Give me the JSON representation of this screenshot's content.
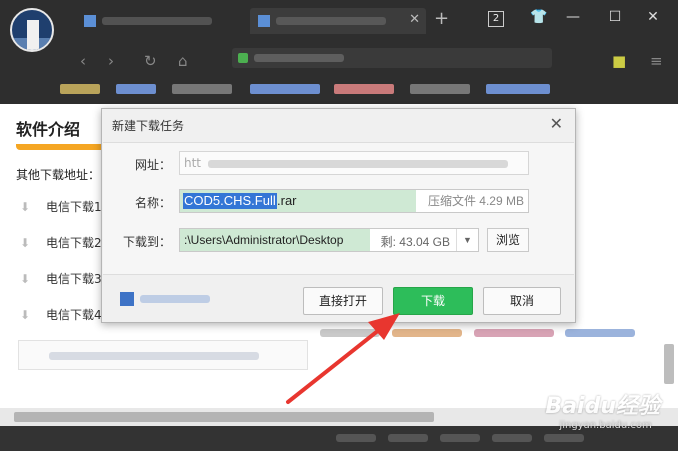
{
  "browser": {
    "tab_count": "2"
  },
  "page": {
    "section_title": "软件介绍",
    "other_links_label": "其他下载地址：",
    "download_links": [
      "电信下载1",
      "电信下载2",
      "电信下载3",
      "电信下载4"
    ]
  },
  "dialog": {
    "title": "新建下载任务",
    "url_label": "网址：",
    "url_value": "htt",
    "name_label": "名称：",
    "name_selected": "COD5.CHS.Full",
    "name_ext": ".rar",
    "file_meta": "压缩文件 4.29 MB",
    "save_to_label": "下载到：",
    "save_path": ":\\Users\\Administrator\\Desktop",
    "free_space": "剩: 43.04 GB",
    "browse_label": "浏览",
    "open_direct_label": "直接打开",
    "download_label": "下载",
    "cancel_label": "取消"
  },
  "watermark": {
    "brand": "Baidu经验",
    "url": "jingyan.baidu.com"
  },
  "colors": {
    "download_button": "#2dbd5a",
    "selection": "#3376d6",
    "annotation_arrow": "#e8362f",
    "section_accent": "#f5a623"
  }
}
